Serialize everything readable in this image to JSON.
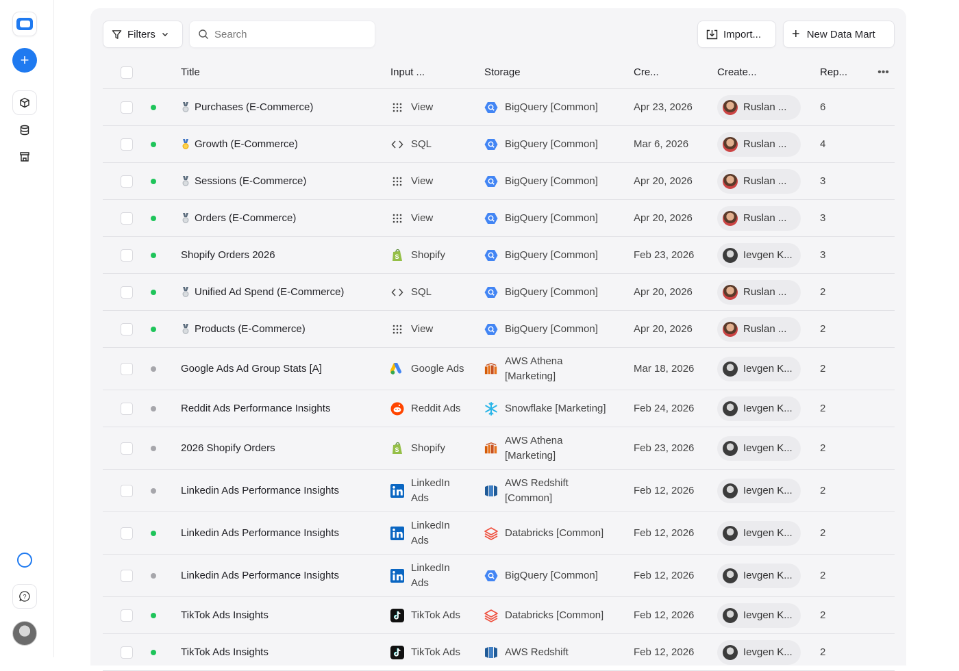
{
  "sidebar": {
    "icons": [
      "app-logo-icon",
      "plus-icon",
      "cube-icon",
      "database-icon",
      "store-icon",
      "ring-icon",
      "chat-help-icon",
      "user-avatar"
    ]
  },
  "toolbar": {
    "filters_label": "Filters",
    "search_placeholder": "Search",
    "import_label": "Import...",
    "new_label": "New Data Mart"
  },
  "table": {
    "headers": {
      "title": "Title",
      "input": "Input ...",
      "storage": "Storage",
      "created": "Cre...",
      "creator": "Create...",
      "reports": "Rep..."
    },
    "rows": [
      {
        "title": "Purchases (E-Commerce)",
        "medal": "silver",
        "active": true,
        "input": "View",
        "input_icon": "grid-icon",
        "storage": "BigQuery [Common]",
        "storage_icon": "bigquery-icon",
        "created": "Apr 23, 2026",
        "creator": "Ruslan ...",
        "creator_avatar": "ruslan",
        "reports": "6"
      },
      {
        "title": "Growth (E-Commerce)",
        "medal": "gold",
        "active": true,
        "input": "SQL",
        "input_icon": "code-icon",
        "storage": "BigQuery [Common]",
        "storage_icon": "bigquery-icon",
        "created": "Mar 6, 2026",
        "creator": "Ruslan ...",
        "creator_avatar": "ruslan",
        "reports": "4"
      },
      {
        "title": "Sessions (E-Commerce)",
        "medal": "silver",
        "active": true,
        "input": "View",
        "input_icon": "grid-icon",
        "storage": "BigQuery [Common]",
        "storage_icon": "bigquery-icon",
        "created": "Apr 20, 2026",
        "creator": "Ruslan ...",
        "creator_avatar": "ruslan",
        "reports": "3"
      },
      {
        "title": "Orders (E-Commerce)",
        "medal": "silver",
        "active": true,
        "input": "View",
        "input_icon": "grid-icon",
        "storage": "BigQuery [Common]",
        "storage_icon": "bigquery-icon",
        "created": "Apr 20, 2026",
        "creator": "Ruslan ...",
        "creator_avatar": "ruslan",
        "reports": "3"
      },
      {
        "title": "Shopify Orders 2026",
        "medal": "",
        "active": true,
        "input": "Shopify",
        "input_icon": "shopify-icon",
        "storage": "BigQuery [Common]",
        "storage_icon": "bigquery-icon",
        "created": "Feb 23, 2026",
        "creator": "Ievgen K...",
        "creator_avatar": "ievgen",
        "reports": "3"
      },
      {
        "title": "Unified Ad Spend (E-Commerce)",
        "medal": "silver",
        "active": true,
        "input": "SQL",
        "input_icon": "code-icon",
        "storage": "BigQuery [Common]",
        "storage_icon": "bigquery-icon",
        "created": "Apr 20, 2026",
        "creator": "Ruslan ...",
        "creator_avatar": "ruslan",
        "reports": "2"
      },
      {
        "title": "Products (E-Commerce)",
        "medal": "silver",
        "active": true,
        "input": "View",
        "input_icon": "grid-icon",
        "storage": "BigQuery [Common]",
        "storage_icon": "bigquery-icon",
        "created": "Apr 20, 2026",
        "creator": "Ruslan ...",
        "creator_avatar": "ruslan",
        "reports": "2"
      },
      {
        "title": "Google Ads Ad Group Stats [A]",
        "medal": "",
        "active": false,
        "input": "Google Ads",
        "input_icon": "google-ads-icon",
        "storage": "AWS Athena [Marketing]",
        "storage_icon": "aws-athena-icon",
        "created": "Mar 18, 2026",
        "creator": "Ievgen K...",
        "creator_avatar": "ievgen",
        "reports": "2"
      },
      {
        "title": "Reddit Ads Performance Insights",
        "medal": "",
        "active": false,
        "input": "Reddit Ads",
        "input_icon": "reddit-icon",
        "storage": "Snowflake [Marketing]",
        "storage_icon": "snowflake-icon",
        "created": "Feb 24, 2026",
        "creator": "Ievgen K...",
        "creator_avatar": "ievgen",
        "reports": "2"
      },
      {
        "title": "2026 Shopify Orders",
        "medal": "",
        "active": false,
        "input": "Shopify",
        "input_icon": "shopify-icon",
        "storage": "AWS Athena [Marketing]",
        "storage_icon": "aws-athena-icon",
        "created": "Feb 23, 2026",
        "creator": "Ievgen K...",
        "creator_avatar": "ievgen",
        "reports": "2"
      },
      {
        "title": "Linkedin Ads Performance Insights",
        "medal": "",
        "active": false,
        "input": "LinkedIn Ads",
        "input_icon": "linkedin-icon",
        "storage": "AWS Redshift [Common]",
        "storage_icon": "aws-redshift-icon",
        "created": "Feb 12, 2026",
        "creator": "Ievgen K...",
        "creator_avatar": "ievgen",
        "reports": "2"
      },
      {
        "title": "Linkedin Ads Performance Insights",
        "medal": "",
        "active": true,
        "input": "LinkedIn Ads",
        "input_icon": "linkedin-icon",
        "storage": "Databricks [Common]",
        "storage_icon": "databricks-icon",
        "created": "Feb 12, 2026",
        "creator": "Ievgen K...",
        "creator_avatar": "ievgen",
        "reports": "2"
      },
      {
        "title": "Linkedin Ads Performance Insights",
        "medal": "",
        "active": false,
        "input": "LinkedIn Ads",
        "input_icon": "linkedin-icon",
        "storage": "BigQuery [Common]",
        "storage_icon": "bigquery-icon",
        "created": "Feb 12, 2026",
        "creator": "Ievgen K...",
        "creator_avatar": "ievgen",
        "reports": "2"
      },
      {
        "title": "TikTok Ads Insights",
        "medal": "",
        "active": true,
        "input": "TikTok Ads",
        "input_icon": "tiktok-icon",
        "storage": "Databricks [Common]",
        "storage_icon": "databricks-icon",
        "created": "Feb 12, 2026",
        "creator": "Ievgen K...",
        "creator_avatar": "ievgen",
        "reports": "2"
      },
      {
        "title": "TikTok Ads Insights",
        "medal": "",
        "active": true,
        "input": "TikTok Ads",
        "input_icon": "tiktok-icon",
        "storage": "AWS Redshift",
        "storage_icon": "aws-redshift-icon",
        "created": "Feb 12, 2026",
        "creator": "Ievgen K...",
        "creator_avatar": "ievgen",
        "reports": "2"
      }
    ]
  },
  "colors": {
    "accent": "#1f7af0",
    "active": "#1ec45a",
    "inactive": "#a6a6ab"
  }
}
